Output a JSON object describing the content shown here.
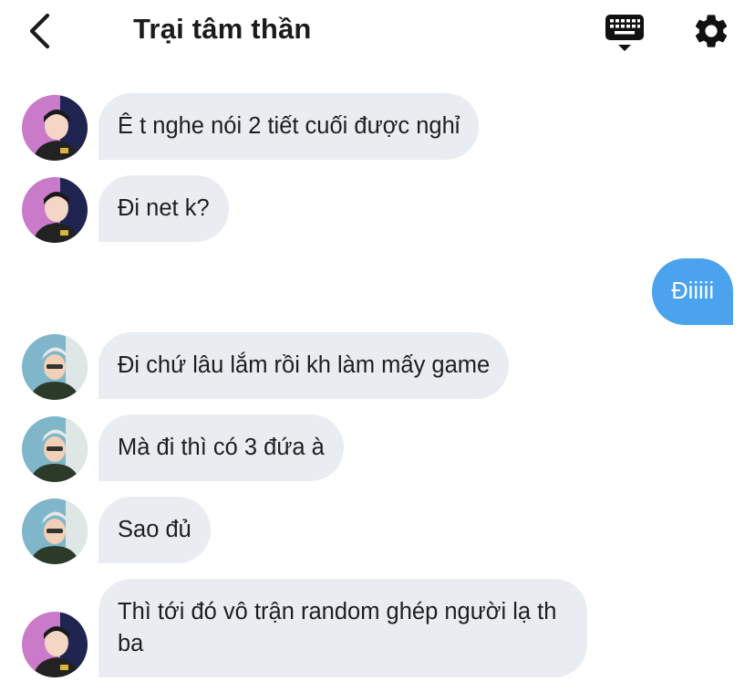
{
  "header": {
    "title": "Trại tâm thần",
    "back_icon": "chevron-left-icon",
    "keyboard_icon": "keyboard-icon",
    "settings_icon": "gear-icon"
  },
  "colors": {
    "incoming_bubble": "#e9edf1",
    "outgoing_bubble": "#4aa3ec",
    "text": "#1e1e1e"
  },
  "messages": [
    {
      "sender": "avatar-a",
      "direction": "incoming",
      "text": "Ê t nghe nói 2 tiết cuối được nghỉ"
    },
    {
      "sender": "avatar-a",
      "direction": "incoming",
      "text": "Đi net k?"
    },
    {
      "sender": "me",
      "direction": "outgoing",
      "text": "Điiiii"
    },
    {
      "sender": "avatar-b",
      "direction": "incoming",
      "text": "Đi chứ lâu lắm rồi kh làm mấy game"
    },
    {
      "sender": "avatar-b",
      "direction": "incoming",
      "text": "Mà đi thì có 3 đứa à"
    },
    {
      "sender": "avatar-b",
      "direction": "incoming",
      "text": "Sao đủ"
    },
    {
      "sender": "avatar-a",
      "direction": "incoming",
      "text": "Thì tới đó vô trận random ghép người lạ th ba"
    }
  ]
}
